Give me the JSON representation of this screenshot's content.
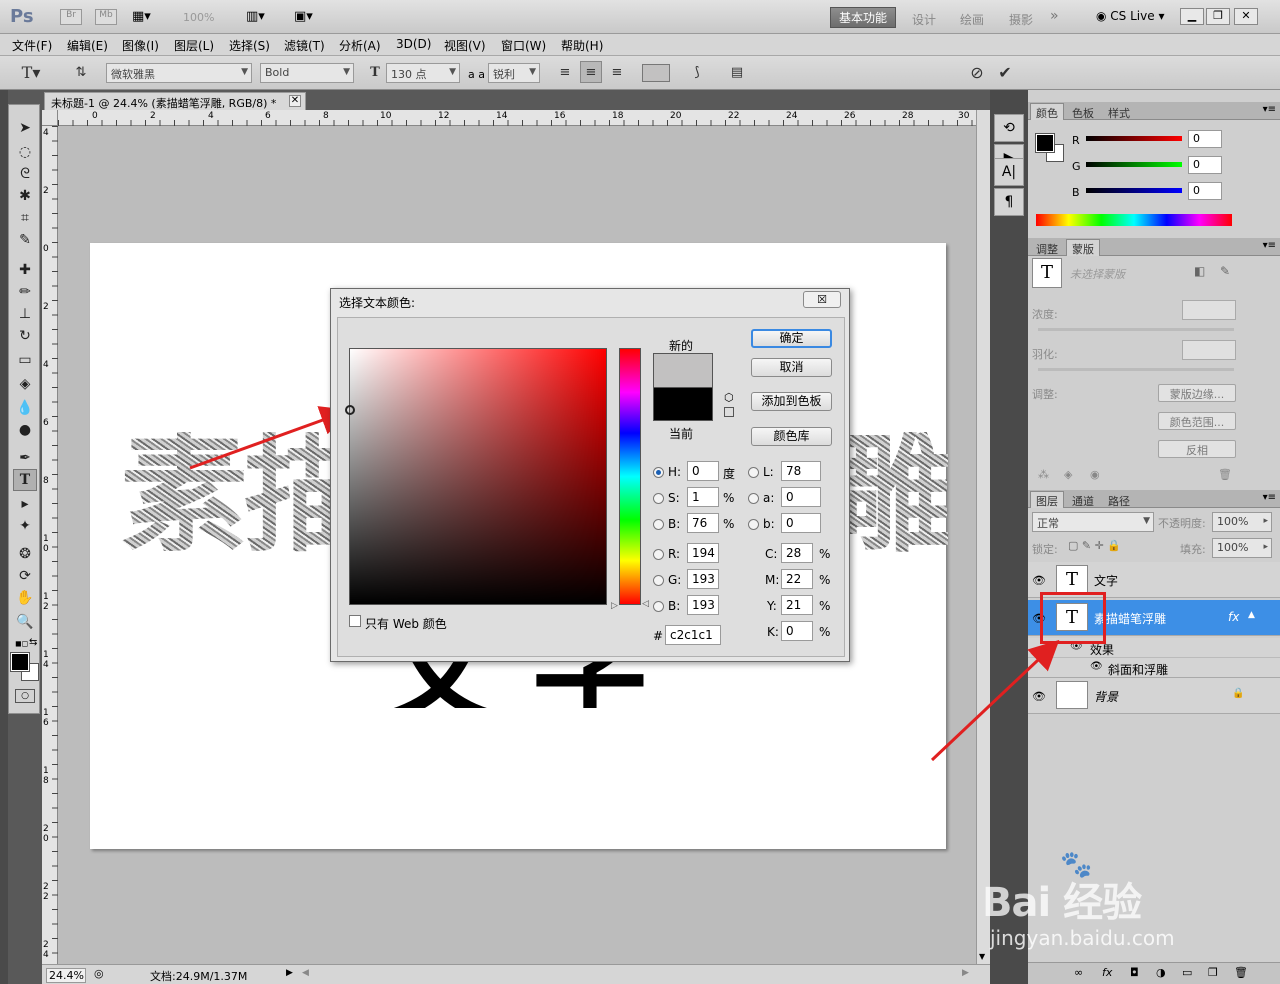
{
  "appbar": {
    "logo": "Ps",
    "bridge": "Br",
    "minibridge": "Mb",
    "zoom": "100%",
    "workspaces": [
      "基本功能",
      "设计",
      "绘画",
      "摄影"
    ],
    "more": "»",
    "cslive": "CS Live"
  },
  "menu": [
    "文件(F)",
    "编辑(E)",
    "图像(I)",
    "图层(L)",
    "选择(S)",
    "滤镜(T)",
    "分析(A)",
    "3D(D)",
    "视图(V)",
    "窗口(W)",
    "帮助(H)"
  ],
  "options": {
    "font_family": "微软雅黑",
    "font_style": "Bold",
    "font_size": "130 点",
    "aa_label": "a a",
    "antialias": "锐利"
  },
  "document": {
    "tab_title": "未标题-1 @ 24.4% (素描蜡笔浮雕, RGB/8) *",
    "ruler_h": [
      "0",
      "2",
      "4",
      "6",
      "8",
      "10",
      "12",
      "14",
      "16",
      "18",
      "20",
      "22",
      "24",
      "26",
      "28",
      "30"
    ],
    "ruler_v": [
      "4",
      "2",
      "0",
      "2",
      "4",
      "6",
      "8",
      "1 0",
      "1 2",
      "1 4",
      "1 6",
      "1 8",
      "2 0",
      "2 2",
      "2 4"
    ],
    "canvas_texture_left": "素描",
    "canvas_texture_right": "雕",
    "canvas_text_black": "文字"
  },
  "status": {
    "zoom": "24.4%",
    "doc": "文档:24.9M/1.37M"
  },
  "dialog": {
    "title": "选择文本颜色:",
    "close": "☒",
    "new_label": "新的",
    "current_label": "当前",
    "ok": "确定",
    "cancel": "取消",
    "add_swatch": "添加到色板",
    "color_libraries": "颜色库",
    "web_only": "只有 Web 颜色",
    "new_color": "#c2c1c1",
    "current_color": "#000000",
    "hsb": {
      "H": "0",
      "S": "1",
      "B": "76"
    },
    "hsb_units": {
      "H": "度",
      "S": "%",
      "B": "%"
    },
    "rgb": {
      "R": "194",
      "G": "193",
      "B": "193"
    },
    "lab": {
      "L": "78",
      "a": "0",
      "b": "0"
    },
    "cmyk": {
      "C": "28",
      "M": "22",
      "Y": "21",
      "K": "0"
    },
    "hex_label": "#",
    "hex": "c2c1c1"
  },
  "color_panel": {
    "tabs": [
      "颜色",
      "色板",
      "样式"
    ],
    "r_label": "R",
    "r": "0",
    "g_label": "G",
    "g": "0",
    "b_label": "B",
    "b": "0"
  },
  "mask_panel": {
    "tabs": [
      "调整",
      "蒙版"
    ],
    "no_mask": "未选择蒙版",
    "density": "浓度:",
    "feather": "羽化:",
    "adjust": "调整:",
    "mask_edge": "蒙版边缘...",
    "color_range": "颜色范围...",
    "invert": "反相"
  },
  "layers_panel": {
    "tabs": [
      "图层",
      "通道",
      "路径"
    ],
    "blend": "正常",
    "opacity_label": "不透明度:",
    "opacity": "100%",
    "lock_label": "锁定:",
    "fill_label": "填充:",
    "fill": "100%",
    "layers": [
      {
        "name": "文字",
        "thumb": "T"
      },
      {
        "name": "素描蜡笔浮雕",
        "thumb": "T",
        "fx": "fx"
      },
      {
        "name": "背景",
        "thumb": ""
      }
    ],
    "effects": "效果",
    "bevel": "斜面和浮雕"
  },
  "watermark": {
    "brand": "Bai 经验",
    "url": "jingyan.baidu.com"
  },
  "colors": {
    "selected_layer": "#3d8fe6",
    "annotation": "#e02020"
  }
}
